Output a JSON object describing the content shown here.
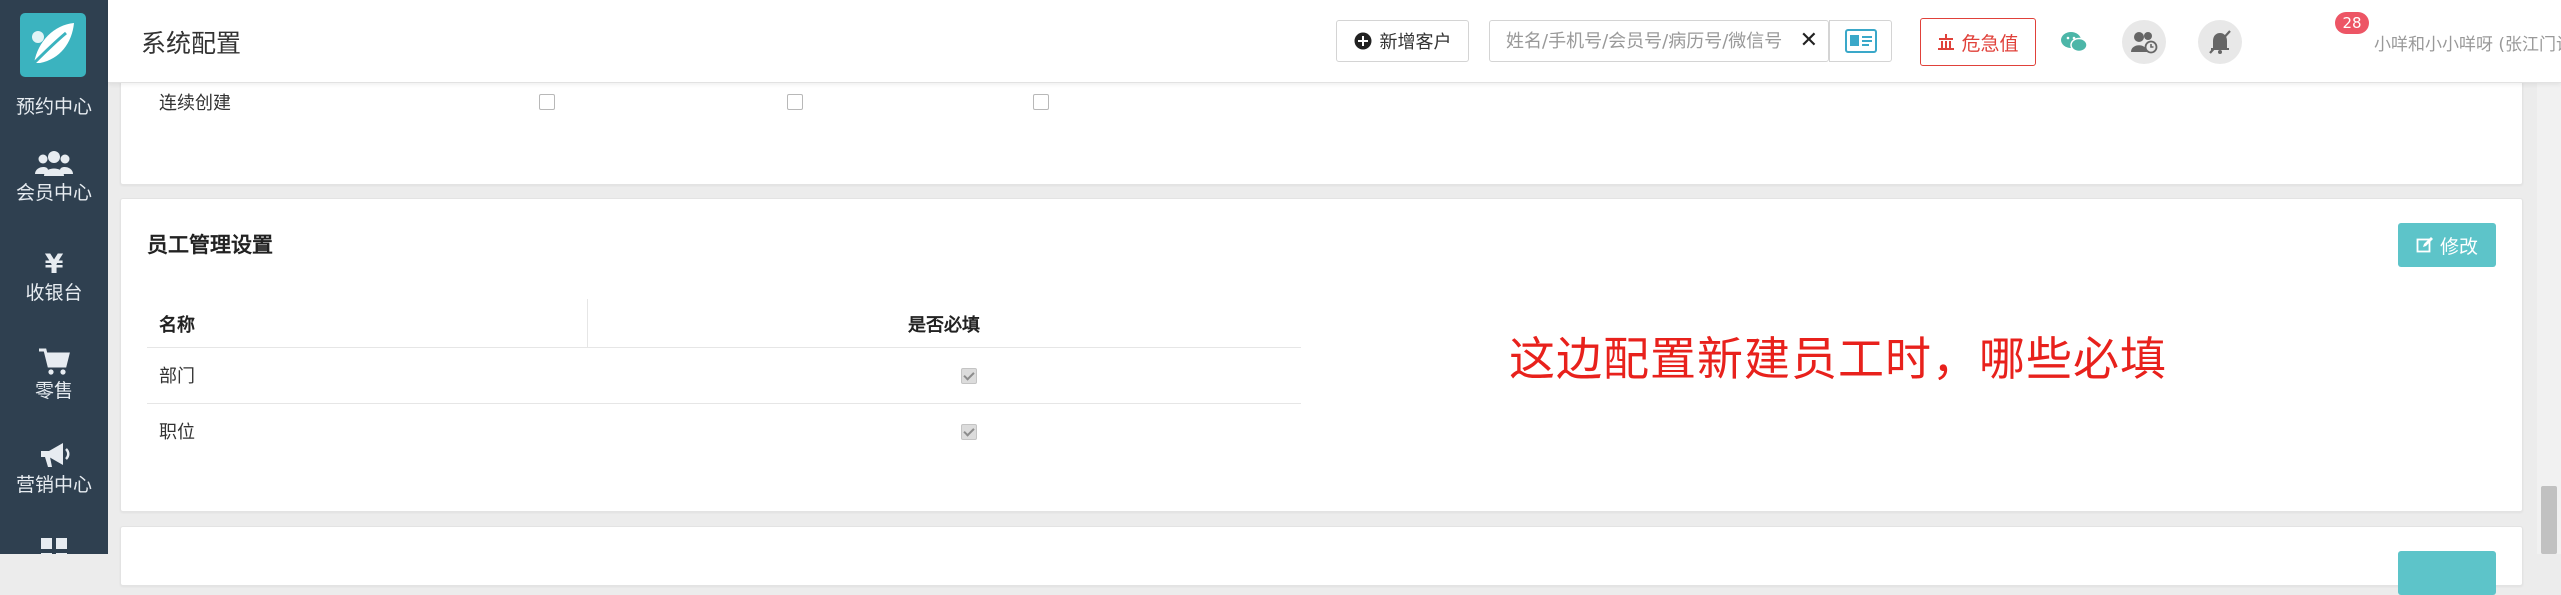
{
  "header": {
    "title": "系统配置",
    "new_customer_label": "新增客户",
    "search_placeholder": "姓名/手机号/会员号/病历号/微信号",
    "clear_symbol": "✕",
    "critical_label": "危急值",
    "notification_count": "28",
    "user_name": "小咩和小小咩呀 (张江门诊部) ⌄"
  },
  "sidebar": {
    "items": [
      {
        "label": "预约中心",
        "icon": "calendar-icon"
      },
      {
        "label": "会员中心",
        "icon": "users-icon"
      },
      {
        "label": "收银台",
        "icon": "yen-icon"
      },
      {
        "label": "零售",
        "icon": "cart-icon"
      },
      {
        "label": "营销中心",
        "icon": "megaphone-icon"
      },
      {
        "label": "",
        "icon": "grid-icon"
      }
    ]
  },
  "top_panel": {
    "row_label": "连续创建",
    "checkboxes": [
      false,
      false,
      false
    ]
  },
  "staff_section": {
    "title": "员工管理设置",
    "edit_label": "修改",
    "columns": [
      "名称",
      "是否必填"
    ],
    "rows": [
      {
        "name": "部门",
        "required": true
      },
      {
        "name": "职位",
        "required": true
      }
    ],
    "annotation": "这边配置新建员工时，哪些必填"
  },
  "colors": {
    "sidebar_bg": "#2f4050",
    "accent": "#5dc4c9",
    "danger": "#e0413a",
    "annotation": "#e8211c"
  }
}
